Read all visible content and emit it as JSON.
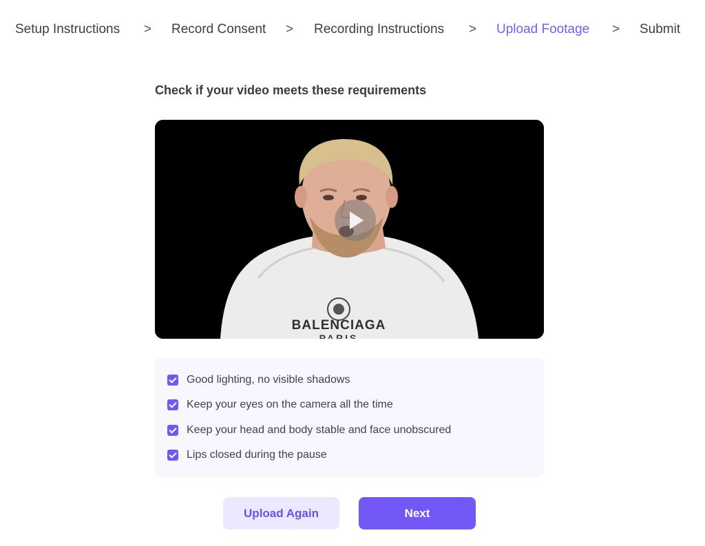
{
  "stepper": {
    "steps": [
      {
        "label": "Setup Instructions"
      },
      {
        "label": "Record Consent"
      },
      {
        "label": "Recording Instructions"
      },
      {
        "label": "Upload Footage"
      },
      {
        "label": "Submit"
      }
    ],
    "separator": ">",
    "active_step": "Upload Footage",
    "active_color": "#7c5cf5"
  },
  "main": {
    "heading": "Check if your video meets these requirements",
    "video": {
      "shirt_text": "BALENCIAGA",
      "shirt_subtext": "PARIS",
      "play_icon": "play-icon"
    },
    "requirements": [
      {
        "label": "Good lighting, no visible shadows",
        "checked": true
      },
      {
        "label": "Keep your eyes on the camera all the time",
        "checked": true
      },
      {
        "label": "Keep your head and body stable and face unobscured",
        "checked": true
      },
      {
        "label": "Lips closed during the pause",
        "checked": true
      }
    ]
  },
  "actions": {
    "upload_again_label": "Upload Again",
    "next_label": "Next"
  },
  "colors": {
    "accent": "#7357f7",
    "secondary_bg": "#ebe9ff",
    "checklist_bg": "#f8f7ff"
  }
}
